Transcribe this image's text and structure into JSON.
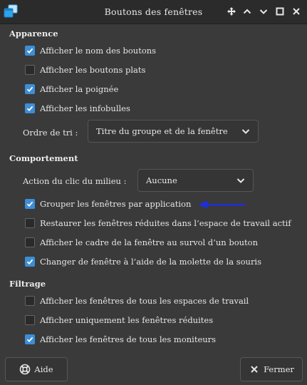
{
  "window": {
    "title": "Boutons des fenêtres",
    "controls": [
      "move-icon",
      "minimize-icon",
      "maximize-icon",
      "close-icon"
    ]
  },
  "sections": {
    "appearance": {
      "title": "Apparence",
      "items": [
        {
          "label": "Afficher le nom des boutons",
          "checked": true
        },
        {
          "label": "Afficher les boutons plats",
          "checked": false
        },
        {
          "label": "Afficher la poignée",
          "checked": true
        },
        {
          "label": "Afficher les infobulles",
          "checked": true
        }
      ],
      "sort": {
        "label": "Ordre de tri :",
        "value": "Titre du groupe et de la fenêtre"
      }
    },
    "behavior": {
      "title": "Comportement",
      "middle_click": {
        "label": "Action du clic du milieu :",
        "value": "Aucune"
      },
      "items": [
        {
          "label": "Grouper les fenêtres par application",
          "checked": true
        },
        {
          "label": "Restaurer les fenêtres réduites dans l’espace de travail actif",
          "checked": false
        },
        {
          "label": "Afficher le cadre de la fenêtre au survol d’un bouton",
          "checked": false
        },
        {
          "label": "Changer de fenêtre à l’aide de la molette de la souris",
          "checked": true
        }
      ]
    },
    "filtering": {
      "title": "Filtrage",
      "items": [
        {
          "label": "Afficher les fenêtres de tous les espaces de travail",
          "checked": false
        },
        {
          "label": "Afficher uniquement les fenêtres réduites",
          "checked": false
        },
        {
          "label": "Afficher les fenêtres de tous les moniteurs",
          "checked": true
        }
      ]
    }
  },
  "buttons": {
    "help": {
      "label": "Aide",
      "icon": "help-lifebuoy-icon"
    },
    "close": {
      "label": "Fermer",
      "icon": "close-x-icon"
    }
  },
  "colors": {
    "accent": "#3d8ed6",
    "annotation_arrow": "#1a2ee8",
    "background": "#3a3a3a",
    "titlebar": "#2b2b2b"
  }
}
